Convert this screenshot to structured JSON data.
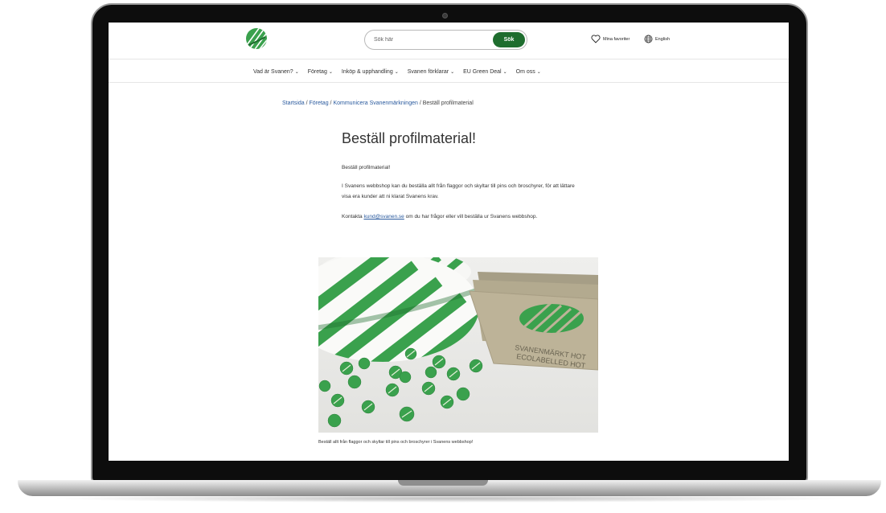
{
  "header": {
    "search_placeholder": "Sök här",
    "search_button": "Sök",
    "favorites_label": "Mina favoriter",
    "language_label": "English"
  },
  "nav": {
    "items": [
      "Vad är Svanen?",
      "Företag",
      "Inköp & upphandling",
      "Svanen förklarar",
      "EU Green Deal",
      "Om oss"
    ]
  },
  "breadcrumb": {
    "home": "Startsida",
    "company": "Företag",
    "communicate": "Kommunicera Svanenmärkningen",
    "current": "Beställ profilmaterial"
  },
  "article": {
    "title": "Beställ profilmaterial!",
    "intro": "Beställ profilmaterial!",
    "body_1": "I Svanens webbshop kan du beställa allt från flaggor och skyltar till pins och broschyrer, för att lättare visa era kunder att ni klarat Svanens krav.",
    "body_2_before": "Kontakta ",
    "body_2_link": "kund@svanen.se",
    "body_2_after": " om du har frågor eller vill beställa ur Svanens webbshop.",
    "caption": "Beställ allt från flaggor och skyltar till pins och broschyrer i Svanens webbshop!",
    "sign_text_1": "SVANENMÄRKT HOT",
    "sign_text_2": "ECOLABELLED HOT"
  },
  "colors": {
    "brand_green": "#1e6d2e",
    "swan_green": "#3aa14d",
    "link_blue": "#2a5a9e"
  },
  "icons": [
    "swan-logo-icon",
    "heart-icon",
    "globe-icon",
    "chevron-down-icon"
  ]
}
